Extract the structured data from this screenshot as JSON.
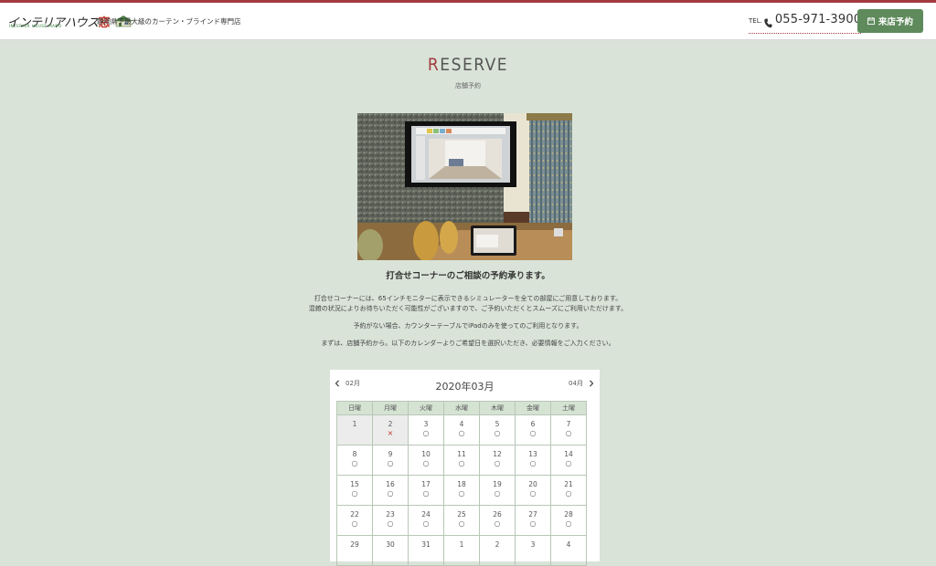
{
  "header": {
    "logo_text_main": "インテリアハウス",
    "logo_text_red": "窓",
    "logo_subtext": "INTERIOR HOUSE MADO",
    "tagline": "静岡県下最大級のカーテン・ブラインド専門店",
    "tel_label": "TEL.",
    "tel_number": "055-971-3900",
    "reserve_button": "来店予約"
  },
  "section": {
    "title_first": "R",
    "title_rest": "ESERVE",
    "subtitle": "店舗予約"
  },
  "content": {
    "headline": "打合せコーナーのご相談の予約承ります。",
    "para1_line1": "打合せコーナーには、65インチモニターに表示できるシミュレーターを全ての部屋にご用意しております。",
    "para1_line2": "混雑の状況によりお待ちいただく可能性がございますので、ご予約いただくとスムーズにご利用いただけます。",
    "para2": "予約がない場合、カウンターテーブルでiPadのみを使ってのご利用となります。",
    "para3": "まずは、店舗予約から。以下のカレンダーよりご希望日を選択いただき、必要情報をご入力ください。"
  },
  "calendar": {
    "prev_label": "02月",
    "next_label": "04月",
    "title": "2020年03月",
    "weekdays": [
      "日曜",
      "月曜",
      "火曜",
      "水曜",
      "木曜",
      "金曜",
      "土曜"
    ],
    "weeks": [
      [
        {
          "d": "1",
          "m": "",
          "past": true
        },
        {
          "d": "2",
          "m": "×",
          "past": true
        },
        {
          "d": "3",
          "m": "○"
        },
        {
          "d": "4",
          "m": "○"
        },
        {
          "d": "5",
          "m": "○"
        },
        {
          "d": "6",
          "m": "○"
        },
        {
          "d": "7",
          "m": "○"
        }
      ],
      [
        {
          "d": "8",
          "m": "○"
        },
        {
          "d": "9",
          "m": "○"
        },
        {
          "d": "10",
          "m": "○"
        },
        {
          "d": "11",
          "m": "○"
        },
        {
          "d": "12",
          "m": "○"
        },
        {
          "d": "13",
          "m": "○"
        },
        {
          "d": "14",
          "m": "○"
        }
      ],
      [
        {
          "d": "15",
          "m": "○"
        },
        {
          "d": "16",
          "m": "○"
        },
        {
          "d": "17",
          "m": "○"
        },
        {
          "d": "18",
          "m": "○"
        },
        {
          "d": "19",
          "m": "○"
        },
        {
          "d": "20",
          "m": "○"
        },
        {
          "d": "21",
          "m": "○"
        }
      ],
      [
        {
          "d": "22",
          "m": "○"
        },
        {
          "d": "23",
          "m": "○"
        },
        {
          "d": "24",
          "m": "○"
        },
        {
          "d": "25",
          "m": "○"
        },
        {
          "d": "26",
          "m": "○"
        },
        {
          "d": "27",
          "m": "○"
        },
        {
          "d": "28",
          "m": "○"
        }
      ],
      [
        {
          "d": "29",
          "m": ""
        },
        {
          "d": "30",
          "m": ""
        },
        {
          "d": "31",
          "m": ""
        },
        {
          "d": "1",
          "m": ""
        },
        {
          "d": "2",
          "m": ""
        },
        {
          "d": "3",
          "m": ""
        },
        {
          "d": "4",
          "m": ""
        }
      ]
    ]
  },
  "colors": {
    "accent_red": "#a33a3f",
    "button_green": "#5f8a5c",
    "page_bg": "#d9e3d8",
    "calendar_header_bg": "#d5e3d3"
  },
  "icons": {
    "phone": "phone-icon",
    "calendar": "calendar-icon",
    "prev": "chevron-left-icon",
    "next": "chevron-right-icon"
  }
}
